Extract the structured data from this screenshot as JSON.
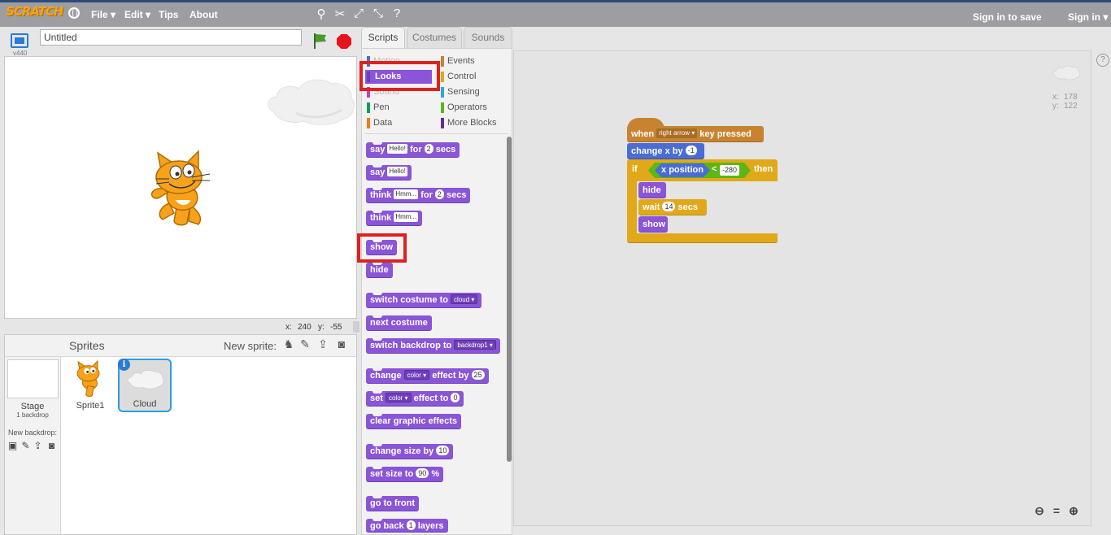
{
  "topbar": {
    "logo": "SCRATCH",
    "menu": [
      "File ▾",
      "Edit ▾",
      "Tips",
      "About"
    ],
    "sign_in_to_save": "Sign in to save",
    "sign_in": "Sign in ▾"
  },
  "stage": {
    "project_title": "Untitled",
    "version": "v440",
    "mouse_x_label": "x:",
    "mouse_x": "240",
    "mouse_y_label": "y:",
    "mouse_y": "-55"
  },
  "sprites_panel": {
    "title": "Sprites",
    "new_sprite_label": "New sprite:",
    "stage_label": "Stage",
    "stage_sub": "1 backdrop",
    "new_backdrop_label": "New backdrop:",
    "sprites": [
      {
        "name": "Sprite1"
      },
      {
        "name": "Cloud"
      }
    ],
    "info_badge": "i"
  },
  "tabs": [
    "Scripts",
    "Costumes",
    "Sounds"
  ],
  "categories": {
    "left": [
      "Motion",
      "Looks",
      "Sound",
      "Pen",
      "Data"
    ],
    "right": [
      "Events",
      "Control",
      "Sensing",
      "Operators",
      "More Blocks"
    ],
    "colors": {
      "Motion": "#4a6cd4",
      "Looks": "#8a55d7",
      "Sound": "#bb42c3",
      "Pen": "#0e9a6c",
      "Data": "#ee7d16",
      "Events": "#c88330",
      "Control": "#e1a91a",
      "Sensing": "#2ca5e2",
      "Operators": "#5cb712",
      "More Blocks": "#632d99"
    }
  },
  "palette_blocks": {
    "say_for": {
      "say": "say",
      "text": "Hello!",
      "for": "for",
      "num": "2",
      "secs": "secs"
    },
    "say": {
      "say": "say",
      "text": "Hello!"
    },
    "think_for": {
      "think": "think",
      "text": "Hmm...",
      "for": "for",
      "num": "2",
      "secs": "secs"
    },
    "think": {
      "think": "think",
      "text": "Hmm..."
    },
    "show": "show",
    "hide": "hide",
    "switch_costume": {
      "label": "switch costume to",
      "value": "cloud ▾"
    },
    "next_costume": "next costume",
    "switch_backdrop": {
      "label": "switch backdrop to",
      "value": "backdrop1 ▾"
    },
    "change_effect": {
      "change": "change",
      "value": "color ▾",
      "effect_by": "effect by",
      "num": "25"
    },
    "set_effect": {
      "set": "set",
      "value": "color ▾",
      "effect_to": "effect to",
      "num": "0"
    },
    "clear_effects": "clear graphic effects",
    "change_size": {
      "label": "change size by",
      "num": "10"
    },
    "set_size": {
      "label": "set size to",
      "num": "90",
      "unit": "%"
    },
    "go_front": "go to front",
    "go_back": {
      "go_back": "go back",
      "num": "1",
      "layers": "layers"
    }
  },
  "scripts_area": {
    "sprite_x_label": "x:",
    "sprite_x": "178",
    "sprite_y_label": "y:",
    "sprite_y": "122",
    "help": "?",
    "script": {
      "when": "when",
      "key": "right arrow ▾",
      "key_pressed": "key pressed",
      "change_x_by": "change x by",
      "change_x_value": "-1",
      "if": "if",
      "x_position": "x position",
      "lt": "<",
      "compare_value": "-280",
      "then": "then",
      "hide": "hide",
      "wait": "wait",
      "wait_value": "14",
      "secs": "secs",
      "show": "show"
    }
  }
}
